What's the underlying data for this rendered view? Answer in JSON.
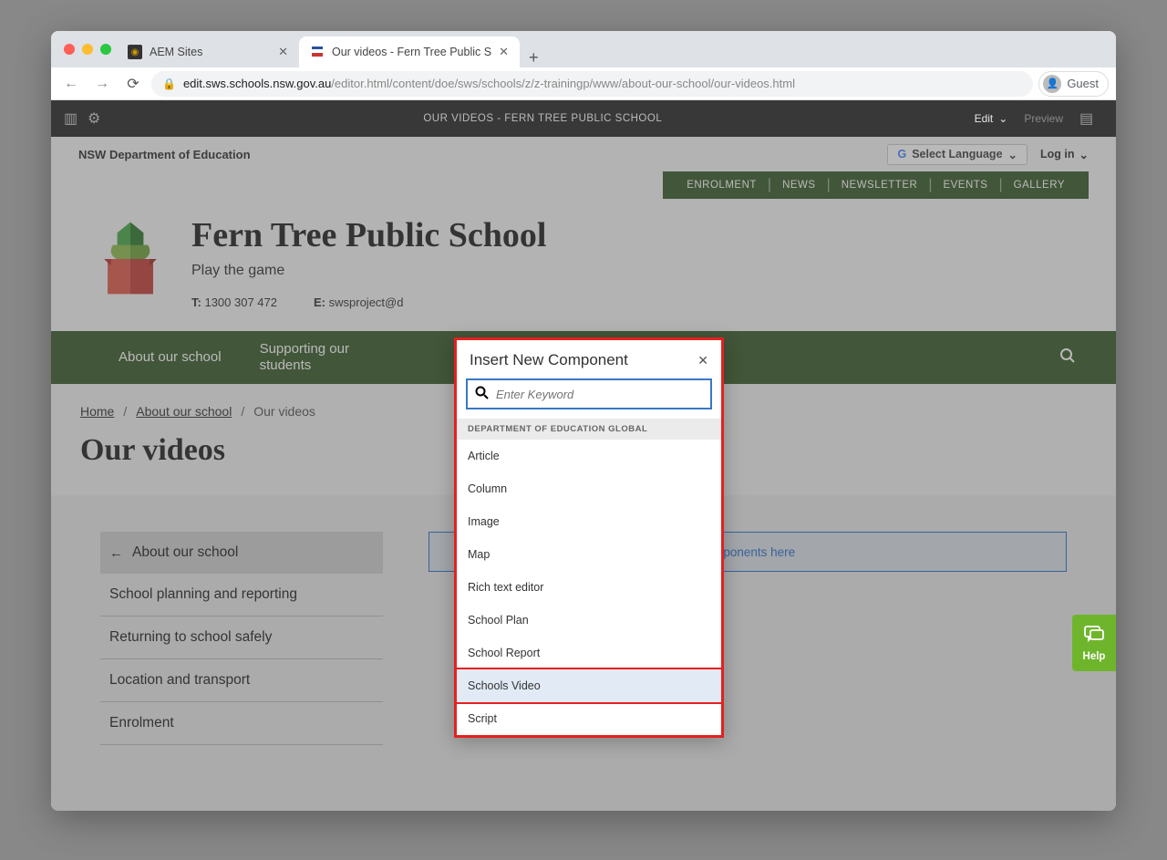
{
  "browser": {
    "tabs": [
      {
        "title": "AEM Sites",
        "active": false
      },
      {
        "title": "Our videos - Fern Tree Public S",
        "active": true
      }
    ],
    "url_host": "edit.sws.schools.nsw.gov.au",
    "url_path": "/editor.html/content/doe/sws/schools/z/z-trainingp/www/about-our-school/our-videos.html",
    "guest_label": "Guest"
  },
  "aem_bar": {
    "title": "OUR VIDEOS - FERN TREE PUBLIC SCHOOL",
    "edit_label": "Edit",
    "preview_label": "Preview"
  },
  "top_strip": {
    "dept": "NSW Department of Education",
    "lang_label": "Select Language",
    "login": "Log in"
  },
  "util_nav": [
    "ENROLMENT",
    "NEWS",
    "NEWSLETTER",
    "EVENTS",
    "GALLERY"
  ],
  "hero": {
    "school_name": "Fern Tree Public School",
    "tagline": "Play the game",
    "phone_label": "T:",
    "phone": "1300 307 472",
    "email_label": "E:",
    "email": "swsproject@d"
  },
  "main_nav": [
    "About our school",
    "Supporting our students"
  ],
  "breadcrumb": {
    "items": [
      "Home",
      "About our school"
    ],
    "current": "Our videos"
  },
  "page_title": "Our videos",
  "side_nav": {
    "current": "About our school",
    "items": [
      "School planning and reporting",
      "Returning to school safely",
      "Location and transport",
      "Enrolment"
    ]
  },
  "drop_text": "components here",
  "help_label": "Help",
  "modal": {
    "title": "Insert New Component",
    "search_placeholder": "Enter Keyword",
    "group_label": "DEPARTMENT OF EDUCATION GLOBAL",
    "items": [
      "Article",
      "Column",
      "Image",
      "Map",
      "Rich text editor",
      "School Plan",
      "School Report",
      "Schools Video",
      "Script"
    ],
    "hovered_index": 7
  }
}
